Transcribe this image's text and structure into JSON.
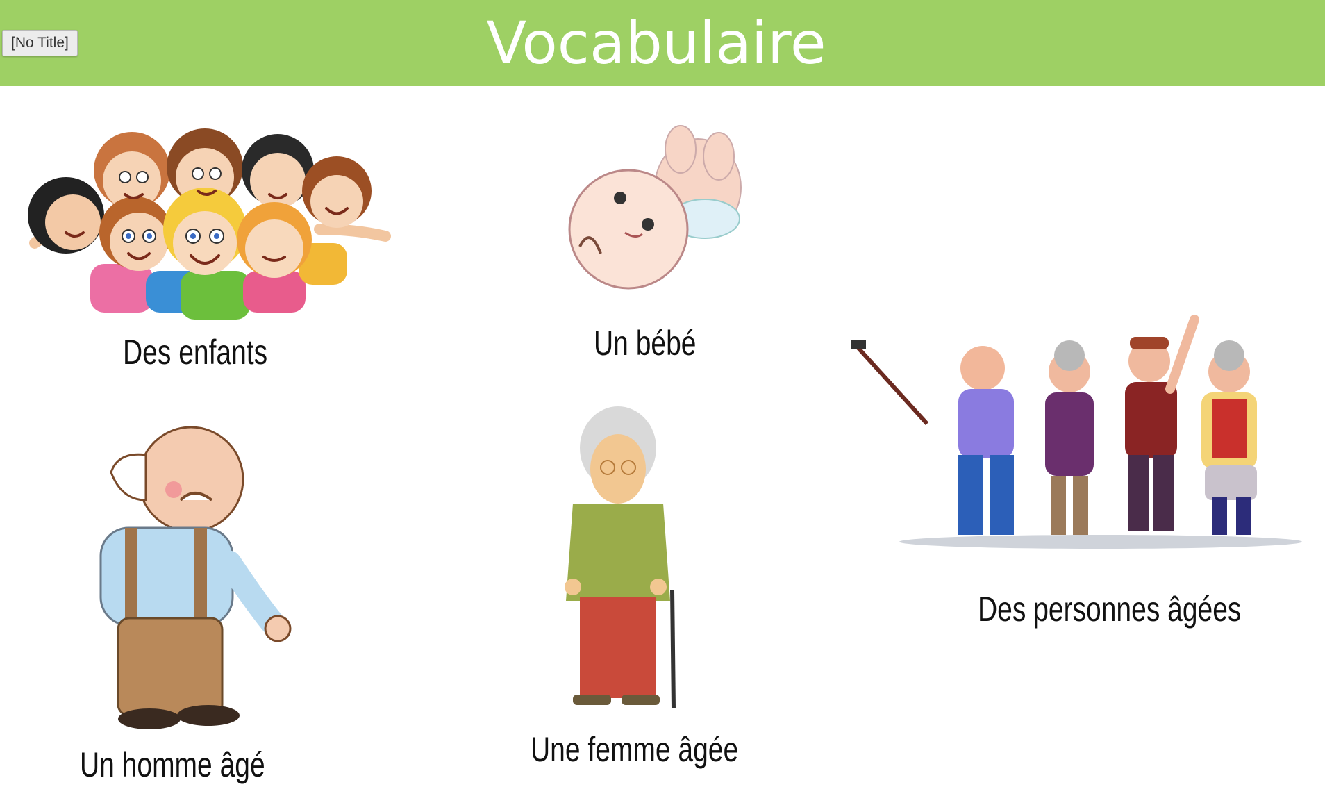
{
  "window": {
    "badge": "[No Title]"
  },
  "slide": {
    "title": "Vocabulaire",
    "items": [
      {
        "label": "Des enfants"
      },
      {
        "label": "Un bébé"
      },
      {
        "label": "Des personnes âgées"
      },
      {
        "label": "Un homme âgé"
      },
      {
        "label": "Une femme âgée"
      }
    ]
  },
  "colors": {
    "banner": "#9ed064",
    "title_text": "#ffffff"
  }
}
